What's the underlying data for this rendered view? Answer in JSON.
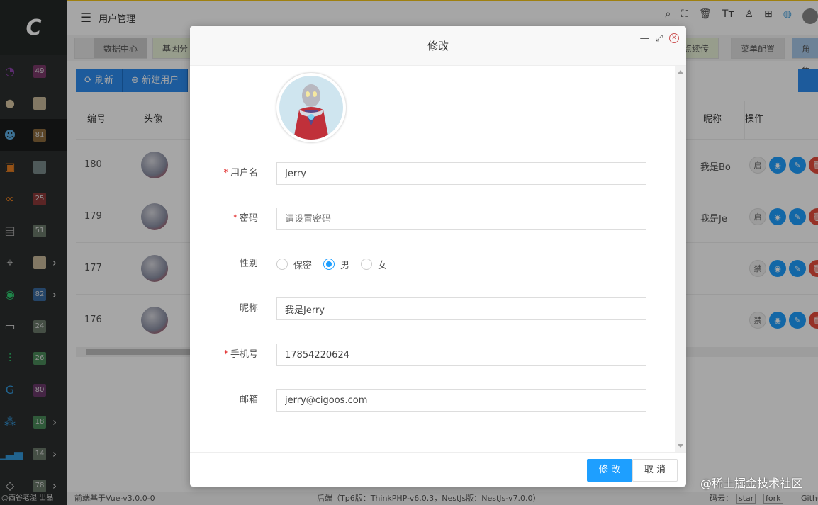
{
  "sidebar": {
    "logo": "C",
    "items": [
      {
        "badge": "49",
        "badge_color": "#7b3a6b",
        "icon": "dashboard-icon",
        "icon_color": "#8e44ad"
      },
      {
        "badge": "",
        "badge_color": "#c8b89a",
        "icon": "user-icon",
        "icon_color": "#d9c7a3"
      },
      {
        "badge": "81",
        "badge_color": "#8c6a3d",
        "icon": "users-icon",
        "icon_color": "#5dade2",
        "active": true
      },
      {
        "badge": "",
        "badge_color": "#7a8a8a",
        "icon": "tv-icon",
        "icon_color": "#e67e22"
      },
      {
        "badge": "25",
        "badge_color": "#8c3a3a",
        "icon": "link-icon",
        "icon_color": "#e67e22"
      },
      {
        "badge": "51",
        "badge_color": "#6a7a6a",
        "icon": "ticket-icon",
        "icon_color": "#a9a9a9"
      },
      {
        "badge": "",
        "badge_color": "#c8b89a",
        "icon": "location-icon",
        "icon_color": "#ddd",
        "chevron": true
      },
      {
        "badge": "82",
        "badge_color": "#3a6aa0",
        "icon": "wechat-icon",
        "icon_color": "#2ecc71",
        "chevron": true
      },
      {
        "badge": "24",
        "badge_color": "#6a7a6a",
        "icon": "folder-icon",
        "icon_color": "#ddd"
      },
      {
        "badge": "26",
        "badge_color": "#4a8a5a",
        "icon": "sliders-icon",
        "icon_color": "#2ecc71"
      },
      {
        "badge": "80",
        "badge_color": "#6a3a6a",
        "icon": "g-icon",
        "icon_color": "#3498db"
      },
      {
        "badge": "18",
        "badge_color": "#4a8a5a",
        "icon": "network-icon",
        "icon_color": "#3498db",
        "chevron": true
      },
      {
        "badge": "14",
        "badge_color": "#6a7a6a",
        "icon": "bar-chart-icon",
        "icon_color": "#3498db",
        "chevron": true
      },
      {
        "badge": "78",
        "badge_color": "#6a7a6a",
        "icon": "diamond-icon",
        "icon_color": "#ddd",
        "chevron": true
      }
    ],
    "footer": "@西谷老湿 出品"
  },
  "topbar": {
    "title": "用户管理"
  },
  "tabs": [
    "数据中心",
    "基因分",
    "点续传",
    "菜单配置",
    "角色"
  ],
  "toolbar": {
    "refresh": "刷新",
    "new_user": "新建用户"
  },
  "table": {
    "headers": {
      "id": "编号",
      "avatar": "头像",
      "nickname": "昵称",
      "actions": "操作"
    },
    "rows": [
      {
        "id": "180",
        "nickname": "我是Bo",
        "toggle": "启"
      },
      {
        "id": "179",
        "nickname": "我是Je",
        "toggle": "启"
      },
      {
        "id": "177",
        "nickname": "",
        "toggle": "禁"
      },
      {
        "id": "176",
        "nickname": "",
        "toggle": "禁"
      }
    ]
  },
  "bottombar": {
    "left": "前端基于Vue-v3.0.0-0",
    "center": "后端（Tp6版：ThinkPHP-v6.0.3，NestJs版：NestJs-v7.0.0）",
    "right": "码云：",
    "right2": "star",
    "right3": "fork",
    "right4": "Githu"
  },
  "modal": {
    "title": "修改",
    "fields": {
      "username": {
        "label": "用户名",
        "value": "Jerry"
      },
      "password": {
        "label": "密码",
        "placeholder": "请设置密码"
      },
      "gender": {
        "label": "性别",
        "options": [
          "保密",
          "男",
          "女"
        ],
        "selected": "男"
      },
      "nickname": {
        "label": "昵称",
        "value": "我是Jerry"
      },
      "phone": {
        "label": "手机号",
        "value": "17854220624"
      },
      "email": {
        "label": "邮箱",
        "value": "jerry@cigoos.com"
      }
    },
    "submit": "修 改",
    "cancel": "取 消"
  },
  "watermark": "@稀土掘金技术社区",
  "colors": {
    "primary": "#1e9fff",
    "required": "#e02020",
    "accent_bar": "#f5c51a"
  }
}
